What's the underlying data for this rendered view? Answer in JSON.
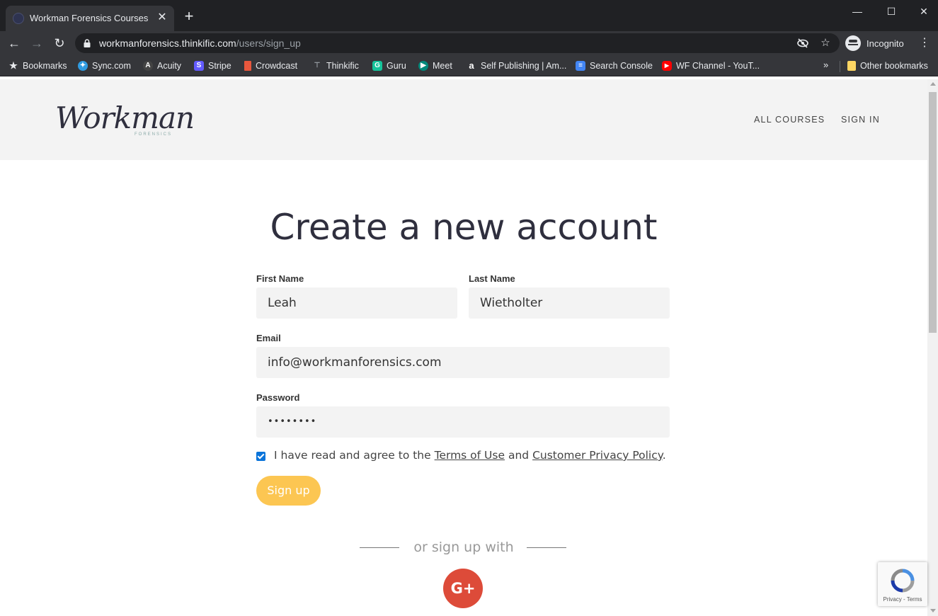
{
  "browser": {
    "tab_title": "Workman Forensics Courses",
    "tab_close": "✕",
    "new_tab": "+",
    "window_controls": {
      "minimize": "—",
      "maximize": "☐",
      "close": "✕"
    },
    "url_host": "workmanforensics.thinkific.com",
    "url_path": "/users/sign_up",
    "profile_label": "Incognito",
    "bookmarks": [
      {
        "label": "Bookmarks",
        "icon": "star-icon",
        "color": "#e8eaed"
      },
      {
        "label": "Sync.com",
        "icon": "sync-icon",
        "color": "#2f9be0"
      },
      {
        "label": "Acuity",
        "icon": "acuity-icon",
        "color": "#444444"
      },
      {
        "label": "Stripe",
        "icon": "stripe-icon",
        "color": "#635bff"
      },
      {
        "label": "Crowdcast",
        "icon": "crowdcast-icon",
        "color": "#e8573d"
      },
      {
        "label": "Thinkific",
        "icon": "thinkific-icon",
        "color": "#3a3a3a"
      },
      {
        "label": "Guru",
        "icon": "guru-icon",
        "color": "#15c39a"
      },
      {
        "label": "Meet",
        "icon": "meet-icon",
        "color": "#00897b"
      },
      {
        "label": "Self Publishing | Am...",
        "icon": "amazon-icon",
        "color": "#ffffff"
      },
      {
        "label": "Search Console",
        "icon": "search-console-icon",
        "color": "#4285f4"
      },
      {
        "label": "WF Channel - YouT...",
        "icon": "youtube-icon",
        "color": "#ff0000"
      }
    ],
    "bookmarks_overflow": "»",
    "other_bookmarks": "Other bookmarks"
  },
  "site": {
    "logo_text": "Workman",
    "logo_subtext": "FORENSICS",
    "nav": {
      "all_courses": "ALL COURSES",
      "sign_in": "SIGN IN"
    }
  },
  "form": {
    "heading": "Create a new account",
    "first_name_label": "First Name",
    "first_name_value": "Leah",
    "last_name_label": "Last Name",
    "last_name_value": "Wietholter",
    "email_label": "Email",
    "email_value": "info@workmanforensics.com",
    "password_label": "Password",
    "password_value": "••••••••",
    "terms_checked": true,
    "terms_prefix": "I have read and agree to the",
    "terms_link": "Terms of Use",
    "terms_and": "and",
    "privacy_link": "Customer Privacy Policy",
    "terms_suffix": ".",
    "submit_label": "Sign up",
    "submit_color": "#fcc652",
    "social_divider": "or sign up with",
    "google_label": "G+",
    "google_color": "#dd4b39"
  },
  "recaptcha": {
    "links": "Privacy - Terms"
  }
}
